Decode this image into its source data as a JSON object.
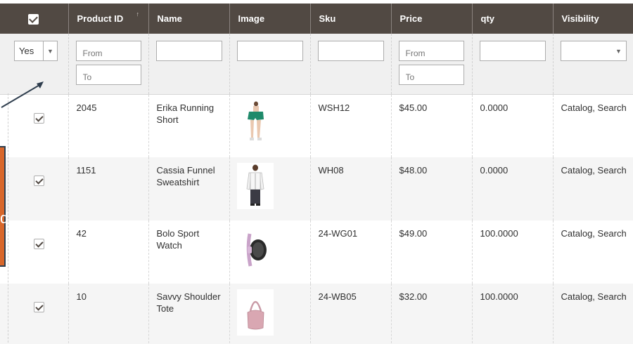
{
  "columns": [
    {
      "key": "select",
      "label": ""
    },
    {
      "key": "product_id",
      "label": "Product ID",
      "sort": "↑"
    },
    {
      "key": "name",
      "label": "Name"
    },
    {
      "key": "image",
      "label": "Image"
    },
    {
      "key": "sku",
      "label": "Sku"
    },
    {
      "key": "price",
      "label": "Price"
    },
    {
      "key": "qty",
      "label": "qty"
    },
    {
      "key": "visibility",
      "label": "Visibility"
    }
  ],
  "filters": {
    "select_value": "Yes",
    "product_id_from": "From",
    "product_id_to": "To",
    "name": "",
    "image": "",
    "sku": "",
    "price_from": "From",
    "price_to": "To",
    "qty": "",
    "visibility": ""
  },
  "rows": [
    {
      "product_id": "2045",
      "name": "Erika Running Short",
      "image": "running-short-thumb",
      "sku": "WSH12",
      "price": "$45.00",
      "qty": "0.0000",
      "visibility": "Catalog, Search"
    },
    {
      "product_id": "1151",
      "name": "Cassia Funnel Sweatshirt",
      "image": "sweatshirt-thumb",
      "sku": "WH08",
      "price": "$48.00",
      "qty": "0.0000",
      "visibility": "Catalog, Search"
    },
    {
      "product_id": "42",
      "name": "Bolo Sport Watch",
      "image": "watch-thumb",
      "sku": "24-WG01",
      "price": "$49.00",
      "qty": "100.0000",
      "visibility": "Catalog, Search"
    },
    {
      "product_id": "10",
      "name": "Savvy Shoulder Tote",
      "image": "tote-bag-thumb",
      "sku": "24-WB05",
      "price": "$32.00",
      "qty": "100.0000",
      "visibility": "Catalog, Search"
    }
  ],
  "callout": {
    "text": "d"
  },
  "colors": {
    "header_bg": "#514943",
    "callout_bg": "#d8672b",
    "callout_border": "#2f3e4e",
    "alt_row": "#f5f5f5"
  }
}
